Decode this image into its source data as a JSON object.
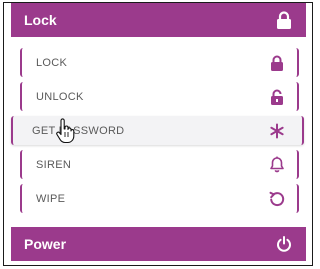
{
  "colors": {
    "accent": "#9b3a8c",
    "text": "#5a5a5a",
    "hover_bg": "#f3f3f5"
  },
  "lock_section": {
    "title": "Lock",
    "icon": "lock-icon"
  },
  "items": [
    {
      "label": "LOCK",
      "icon": "lock-icon"
    },
    {
      "label": "UNLOCK",
      "icon": "unlock-icon"
    },
    {
      "label": "GET PASSWORD",
      "icon": "asterisk-icon",
      "hovered": true
    },
    {
      "label": "SIREN",
      "icon": "bell-icon"
    },
    {
      "label": "WIPE",
      "icon": "reset-icon"
    }
  ],
  "power_section": {
    "title": "Power",
    "icon": "power-icon"
  }
}
